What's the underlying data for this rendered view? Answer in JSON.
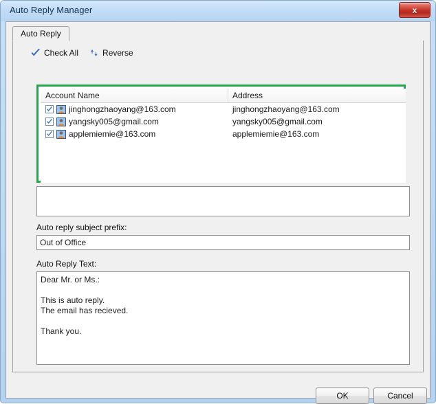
{
  "window": {
    "title": "Auto Reply Manager",
    "close_label": "x",
    "close_icon": "close-icon"
  },
  "tabs": [
    {
      "label": "Auto Reply",
      "selected": true
    }
  ],
  "toolbar": {
    "check_all_label": "Check All",
    "check_all_icon": "checkmark-icon",
    "reverse_label": "Reverse",
    "reverse_icon": "up-down-arrows-icon"
  },
  "accounts_table": {
    "columns": [
      "Account Name",
      "Address"
    ],
    "rows": [
      {
        "checked": true,
        "icon": "contact-icon",
        "account_name": "jinghongzhaoyang@163.com",
        "address": "jinghongzhaoyang@163.com"
      },
      {
        "checked": true,
        "icon": "contact-icon",
        "account_name": "yangsky005@gmail.com",
        "address": "yangsky005@gmail.com"
      },
      {
        "checked": true,
        "icon": "contact-icon",
        "account_name": "applemiemie@163.com",
        "address": "applemiemie@163.com"
      }
    ]
  },
  "details_panel": {
    "content": ""
  },
  "subject": {
    "label": "Auto reply subject prefix:",
    "value": "Out of Office",
    "placeholder": ""
  },
  "body": {
    "label": "Auto Reply Text:",
    "value": "Dear Mr. or Ms.:\n\nThis is auto reply.\nThe email has recieved.\n\nThank you.",
    "placeholder": ""
  },
  "buttons": {
    "ok_label": "OK",
    "cancel_label": "Cancel"
  },
  "colors": {
    "highlight_border": "#22a74c",
    "titlebar": "#bcd9f4",
    "close_button": "#c53227",
    "accent_blue": "#2f6fba"
  }
}
